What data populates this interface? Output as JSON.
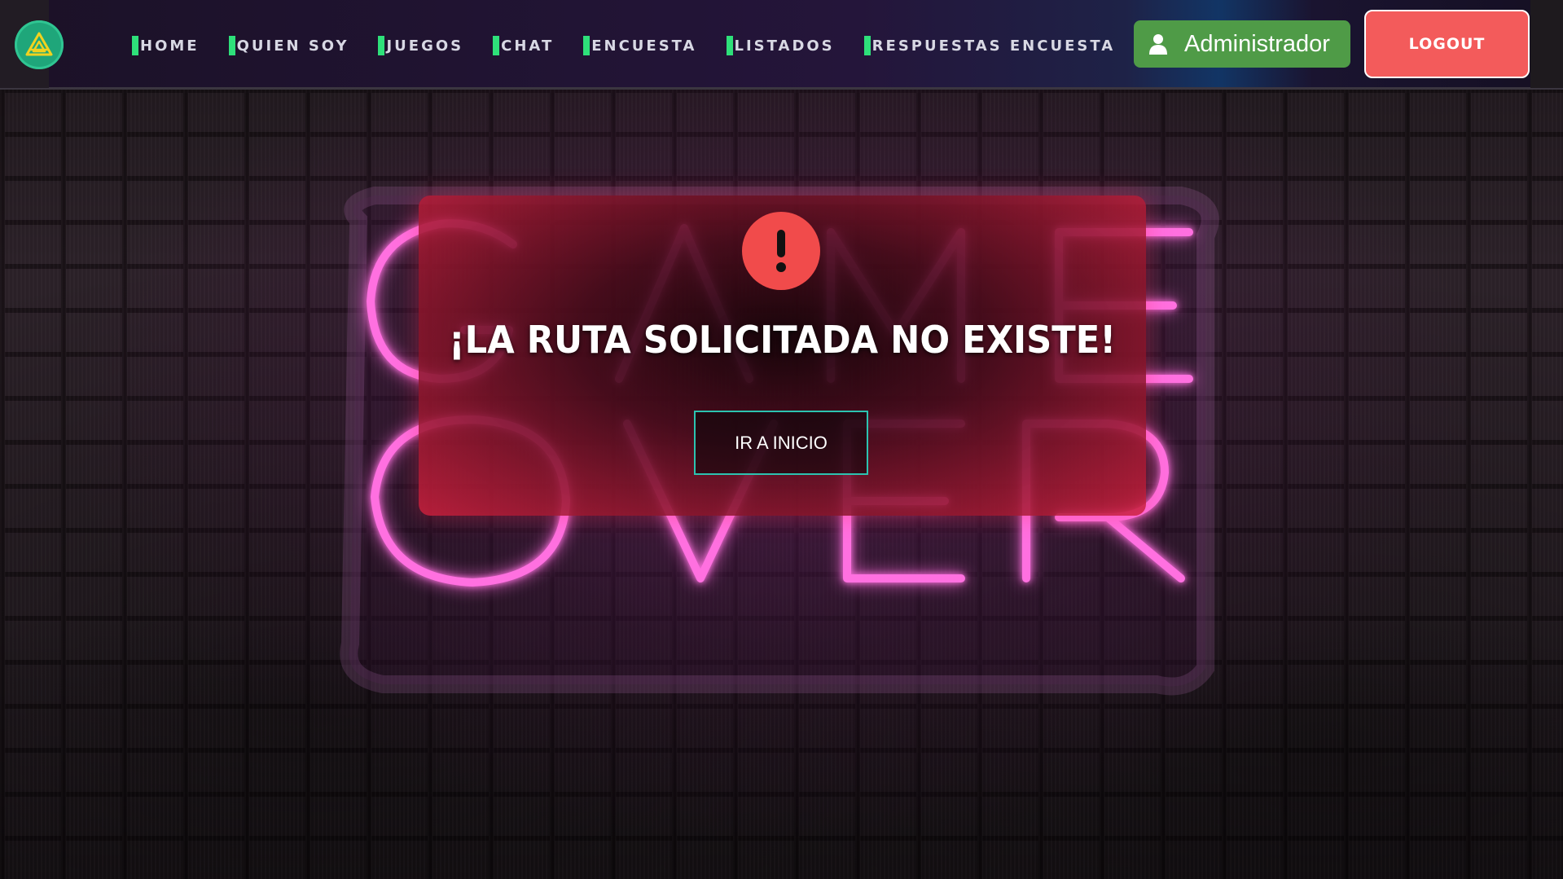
{
  "navbar": {
    "logo_icon": "triangle-logo-icon",
    "links": [
      {
        "label": "HOME"
      },
      {
        "label": "QUIEN SOY"
      },
      {
        "label": "JUEGOS"
      },
      {
        "label": "CHAT"
      },
      {
        "label": "ENCUESTA"
      },
      {
        "label": "LISTADOS"
      },
      {
        "label": "RESPUESTAS ENCUESTA"
      }
    ],
    "user": {
      "icon": "user-icon",
      "name": "Administrador",
      "color": "#4f9b47"
    },
    "logout_label": "LOGOUT",
    "logout_color": "#f35b5b",
    "accent": "#2ee07a"
  },
  "background": {
    "sign_line1": "GAME",
    "sign_line2": "OVER",
    "neon_color": "#ff4fd8"
  },
  "error": {
    "icon": "exclamation-icon",
    "title": "¡LA RUTA SOLICITADA NO EXISTE!",
    "button_label": "IR A INICIO",
    "button_border": "#2cc3b0"
  }
}
